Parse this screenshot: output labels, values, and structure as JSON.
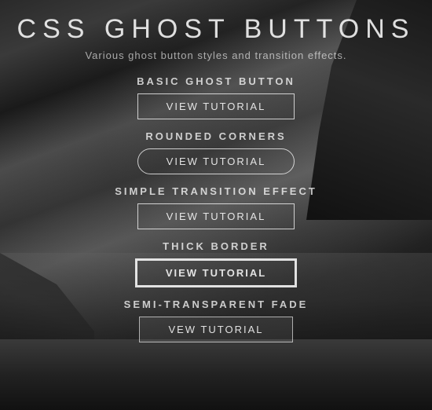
{
  "page": {
    "title": "CSS GHOST BUTTONS",
    "subtitle": "Various ghost button styles and transition effects.",
    "sections": [
      {
        "id": "basic",
        "title": "BASIC GHOST BUTTON",
        "button_label": "View Tutorial",
        "style": "basic"
      },
      {
        "id": "rounded",
        "title": "ROUNDED CORNERS",
        "button_label": "View Tutorial",
        "style": "rounded"
      },
      {
        "id": "transition",
        "title": "SIMPLE TRANSITION EFFECT",
        "button_label": "View Tutorial",
        "style": "basic"
      },
      {
        "id": "thick",
        "title": "THICK BORDER",
        "button_label": "View Tutorial",
        "style": "thick"
      },
      {
        "id": "semi-fade",
        "title": "SEMI-TRANSPARENT FADE",
        "button_label": "Vew Tutorial",
        "style": "semi-fade"
      }
    ]
  }
}
